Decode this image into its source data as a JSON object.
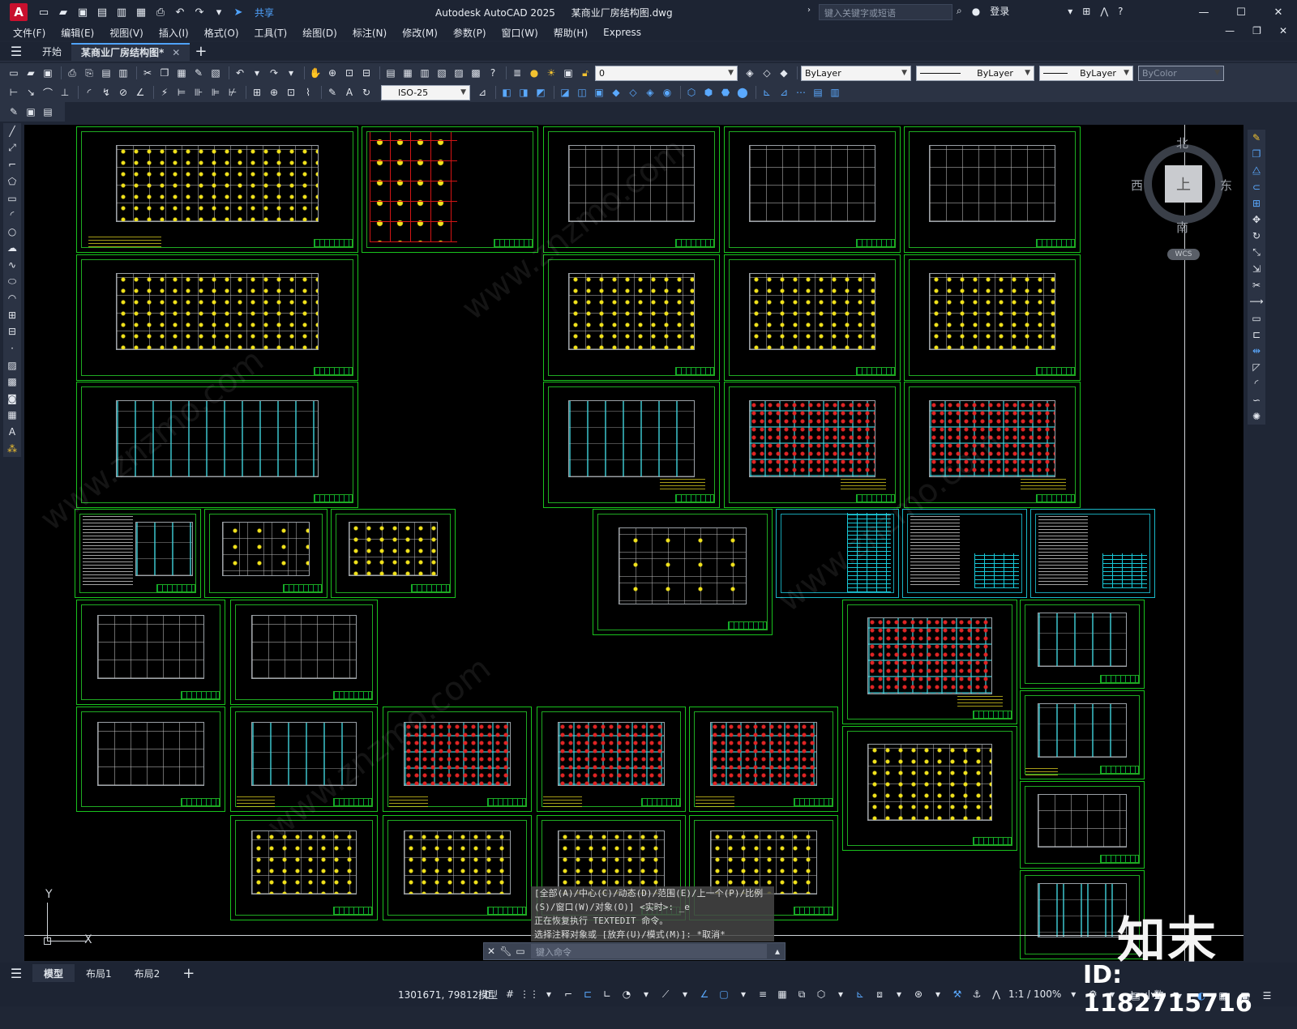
{
  "titlebar": {
    "app_letter": "A",
    "share_label": "共享",
    "app_name": "Autodesk AutoCAD 2025",
    "document": "某商业厂房结构图.dwg",
    "search_placeholder": "键入关键字或短语",
    "login_label": "登录"
  },
  "menu": [
    "文件(F)",
    "编辑(E)",
    "视图(V)",
    "插入(I)",
    "格式(O)",
    "工具(T)",
    "绘图(D)",
    "标注(N)",
    "修改(M)",
    "参数(P)",
    "窗口(W)",
    "帮助(H)",
    "Express"
  ],
  "file_tabs": {
    "start": "开始",
    "active": "某商业厂房结构图*"
  },
  "properties": {
    "layer": "0",
    "color": "ByLayer",
    "linetype": "ByLayer",
    "lineweight": "ByLayer",
    "plotstyle": "ByColor",
    "dimstyle": "ISO-25"
  },
  "viewcube": {
    "north": "北",
    "south": "南",
    "west": "西",
    "east": "东",
    "top": "上",
    "wcs": "WCS"
  },
  "ucs": {
    "x": "X",
    "y": "Y"
  },
  "command": {
    "history": [
      "[全部(A)/中心(C)/动态(D)/范围(E)/上一个(P)/比例",
      "(S)/窗口(W)/对象(O)] <实时>: _e",
      "正在恢复执行 TEXTEDIT 命令。",
      "选择注释对象或 [放弃(U)/模式(M)]: *取消*"
    ],
    "placeholder": "键入命令"
  },
  "layout_tabs": [
    "模型",
    "布局1",
    "布局2"
  ],
  "status": {
    "coords": "1301671, 79812, 0",
    "model": "模型",
    "scale": "1:1 / 100%",
    "units": "小数"
  },
  "watermark": {
    "logo": "知末",
    "id": "ID: 1182715716",
    "site": "www.znzmo.com"
  },
  "colors": {
    "background": "#1f2635",
    "canvas": "#000000",
    "frame_green": "#19c21d",
    "frame_cyan": "#19b8c8",
    "accent": "#4fa3ff"
  }
}
